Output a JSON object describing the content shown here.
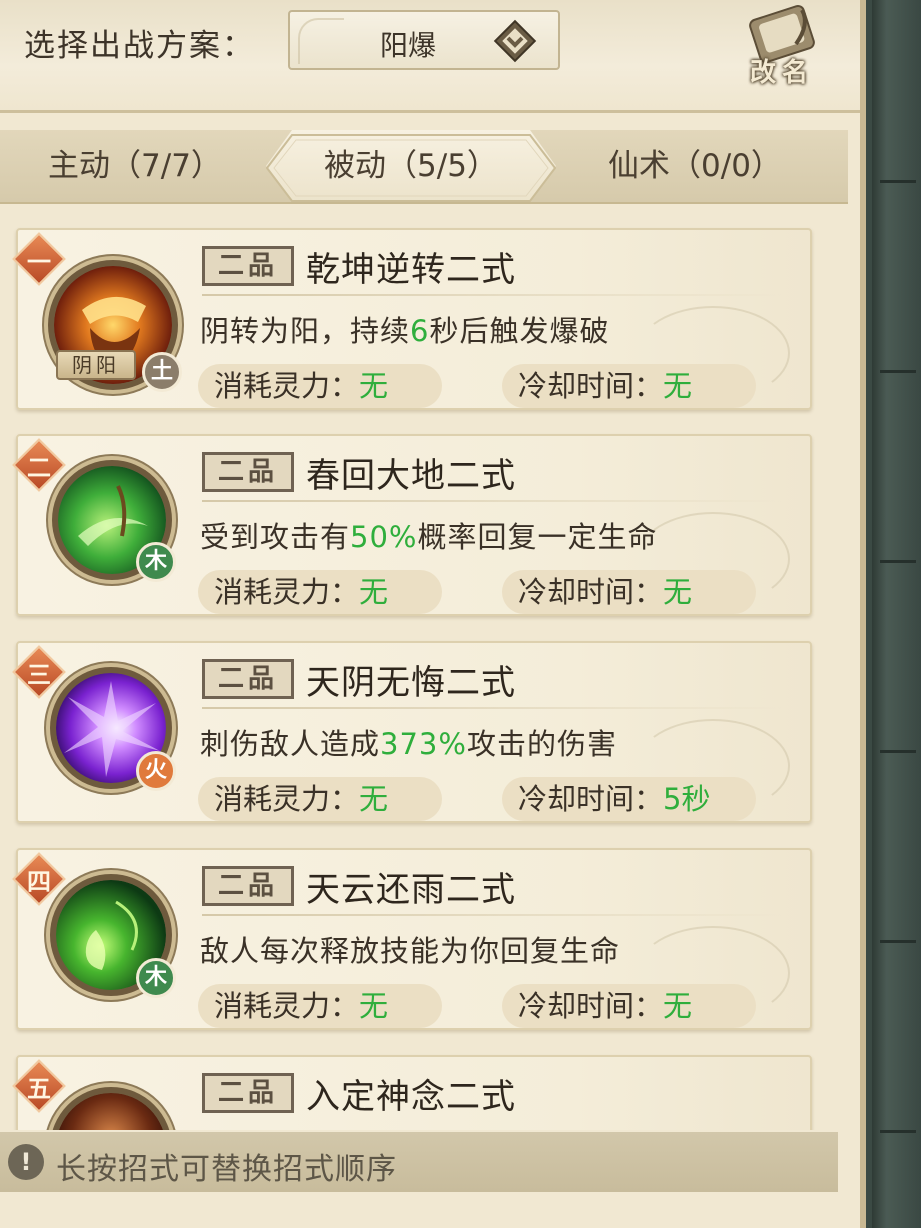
{
  "header": {
    "label": "选择出战方案：",
    "plan_value": "阳爆",
    "rename_label": "改名"
  },
  "tabs": [
    {
      "label": "主动（7/7）",
      "active": false
    },
    {
      "label": "被动（5/5）",
      "active": true
    },
    {
      "label": "仙术（0/0）",
      "active": false
    }
  ],
  "skills": [
    {
      "rank": "一",
      "grade": "二品",
      "name": "乾坤逆转二式",
      "desc_pre": "阴转为阳，持续",
      "desc_hl": "6",
      "desc_post": "秒后触发爆破",
      "cost_label": "消耗灵力：",
      "cost_value": "无",
      "cd_label": "冷却时间：",
      "cd_value": "无",
      "element": "土",
      "element_color": "#8b7d6a",
      "tag": "阴阳",
      "icon": "yinyang-burst-icon"
    },
    {
      "rank": "二",
      "grade": "二品",
      "name": "春回大地二式",
      "desc_pre": "受到攻击有",
      "desc_hl": "50%",
      "desc_post": "概率回复一定生命",
      "cost_label": "消耗灵力：",
      "cost_value": "无",
      "cd_label": "冷却时间：",
      "cd_value": "无",
      "element": "木",
      "element_color": "#3f8a4e",
      "icon": "leaf-swirl-icon"
    },
    {
      "rank": "三",
      "grade": "二品",
      "name": "天阴无悔二式",
      "desc_pre": "刺伤敌人造成",
      "desc_hl": "373%",
      "desc_post": "攻击的伤害",
      "cost_label": "消耗灵力：",
      "cost_value": "无",
      "cd_label": "冷却时间：",
      "cd_value": "5秒",
      "element": "火",
      "element_color": "#e07a3c",
      "icon": "purple-burst-icon"
    },
    {
      "rank": "四",
      "grade": "二品",
      "name": "天云还雨二式",
      "desc_pre": "敌人每次释放技能为你回复生命",
      "desc_hl": "",
      "desc_post": "",
      "cost_label": "消耗灵力：",
      "cost_value": "无",
      "cd_label": "冷却时间：",
      "cd_value": "无",
      "element": "木",
      "element_color": "#3f8a4e",
      "icon": "green-droplet-icon"
    },
    {
      "rank": "五",
      "grade": "二品",
      "name": "入定神念二式",
      "icon": "meditation-icon"
    }
  ],
  "tip": {
    "icon": "exclamation-icon",
    "text": "长按招式可替换招式顺序"
  },
  "colors": {
    "highlight": "#2fae3c",
    "panel_bg": "#f1e8d2",
    "rank_badge": "#c9582d"
  }
}
